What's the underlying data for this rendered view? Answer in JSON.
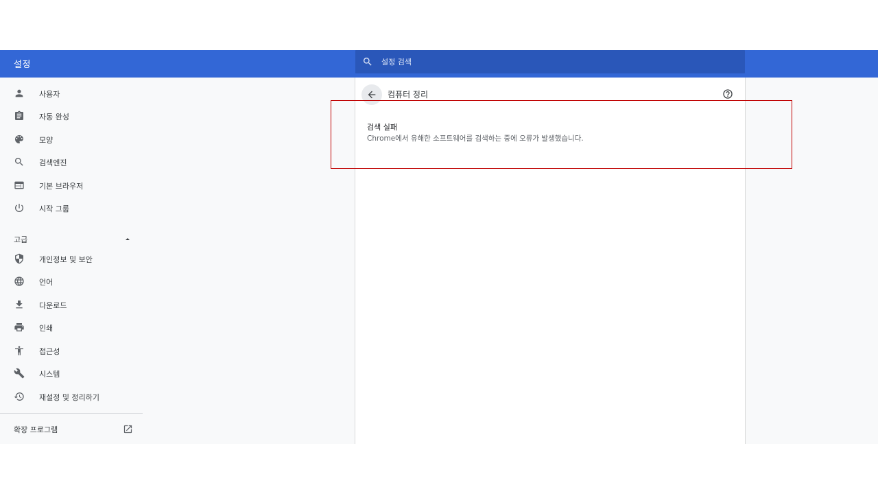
{
  "header": {
    "title": "설정",
    "search_placeholder": "설정 검색"
  },
  "sidebar": {
    "items": [
      {
        "label": "사용자",
        "icon": "person-icon"
      },
      {
        "label": "자동 완성",
        "icon": "clipboard-icon"
      },
      {
        "label": "모양",
        "icon": "palette-icon"
      },
      {
        "label": "검색엔진",
        "icon": "search-icon"
      },
      {
        "label": "기본 브라우저",
        "icon": "browser-icon"
      },
      {
        "label": "시작 그룹",
        "icon": "power-icon"
      }
    ],
    "advanced_label": "고급",
    "advanced_items": [
      {
        "label": "개인정보 및 보안",
        "icon": "shield-icon"
      },
      {
        "label": "언어",
        "icon": "globe-icon"
      },
      {
        "label": "다운로드",
        "icon": "download-icon"
      },
      {
        "label": "인쇄",
        "icon": "printer-icon"
      },
      {
        "label": "접근성",
        "icon": "accessibility-icon"
      },
      {
        "label": "시스템",
        "icon": "wrench-icon"
      },
      {
        "label": "재설정 및 정리하기",
        "icon": "restore-icon"
      }
    ],
    "extensions_label": "확장 프로그램"
  },
  "page": {
    "title": "컴퓨터 정리",
    "result_title": "검색 실패",
    "result_desc": "Chrome에서 유해한 소프트웨어를 검색하는 중에 오류가 발생했습니다."
  },
  "colors": {
    "accent": "#3367d6",
    "search_bg": "#2a57b9",
    "highlight_border": "#c00000"
  }
}
